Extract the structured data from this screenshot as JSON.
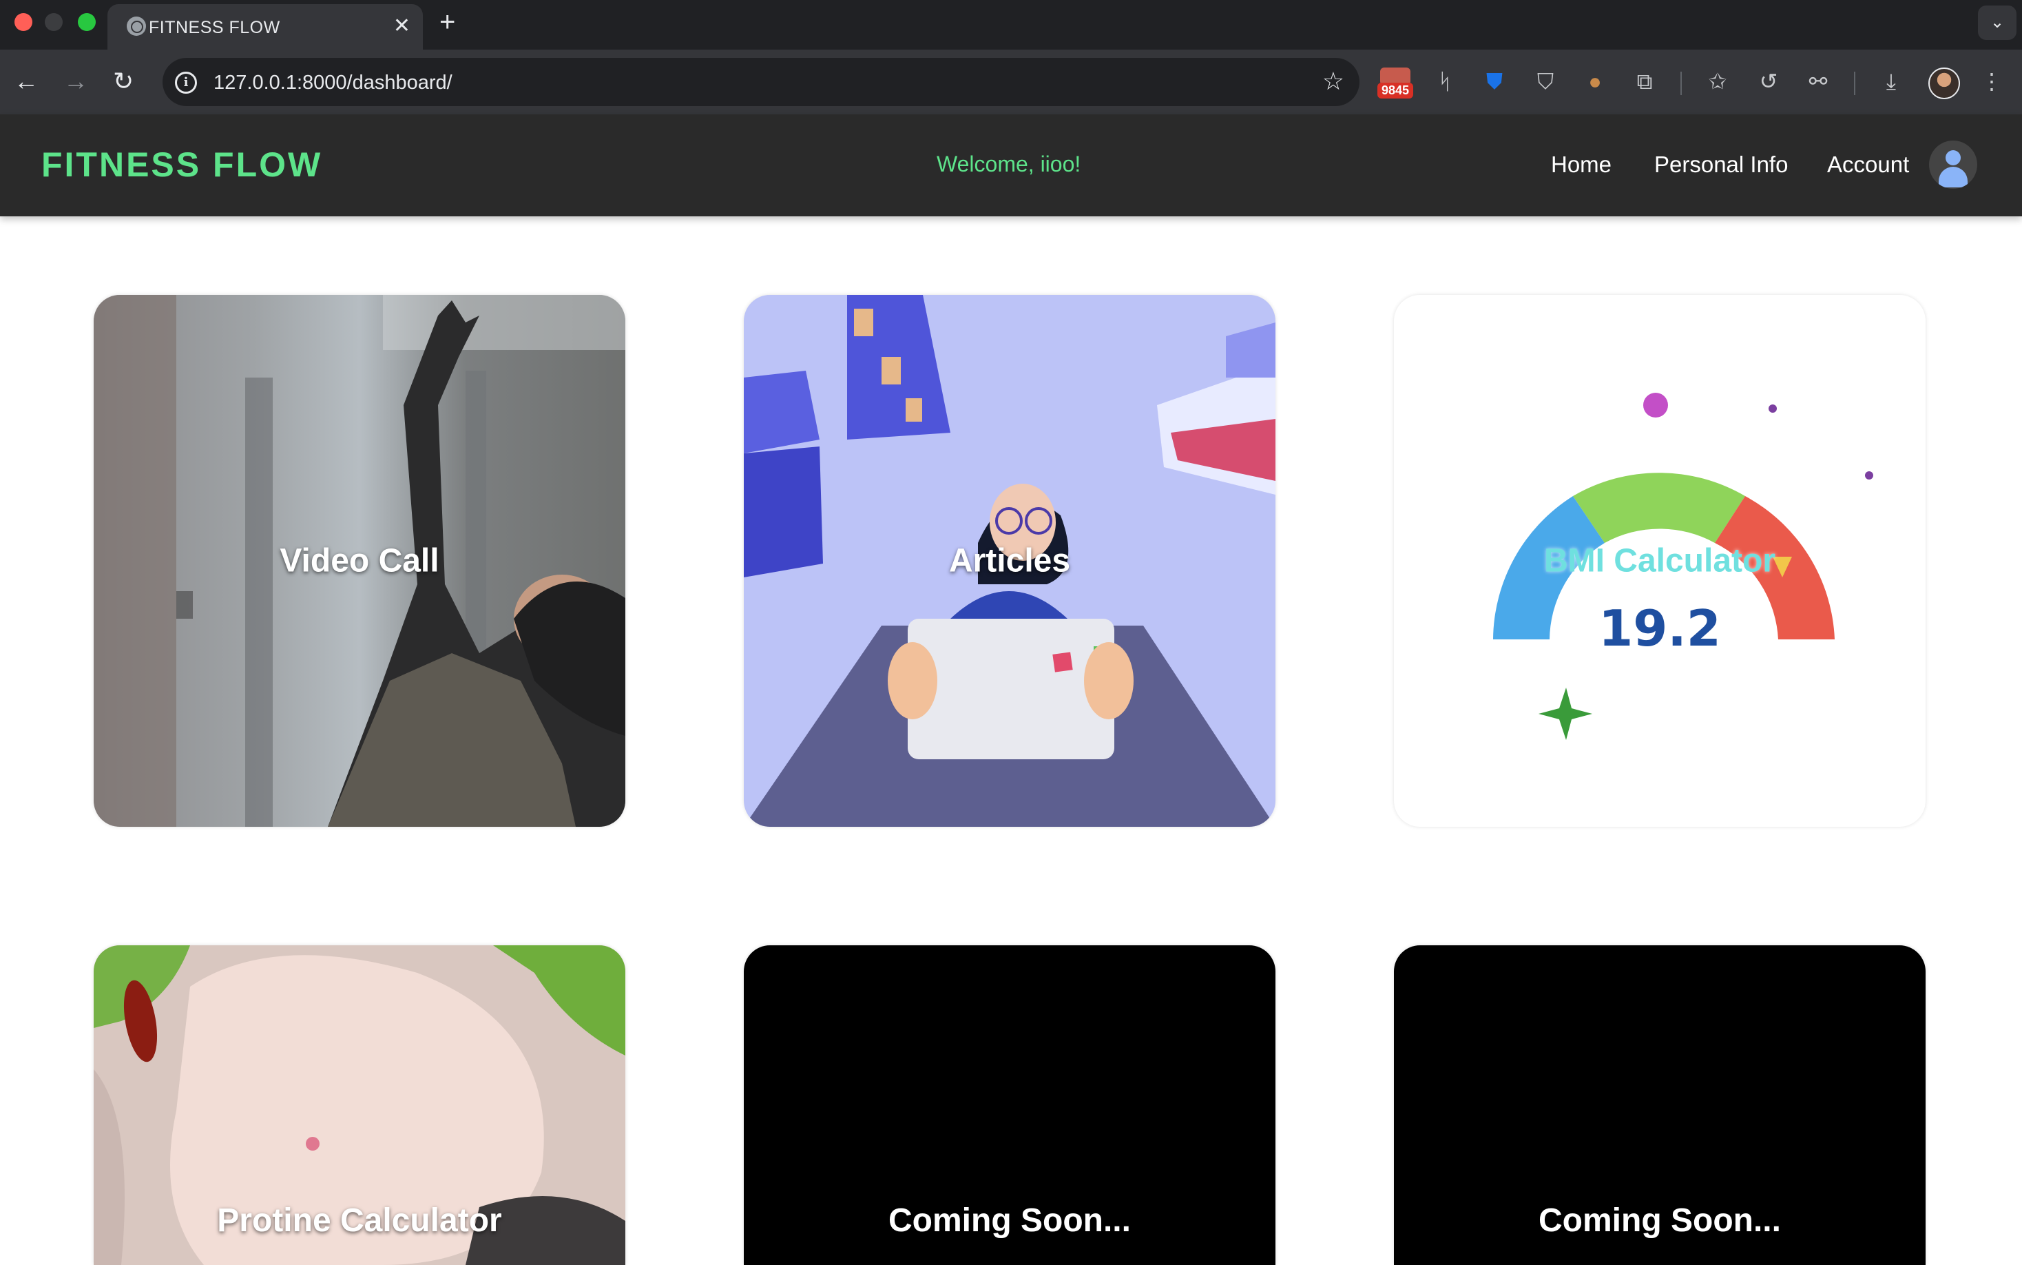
{
  "browser": {
    "tab_title": "FITNESS FLOW",
    "tab_close_glyph": "✕",
    "new_tab_glyph": "+",
    "url": "127.0.0.1:8000/dashboard/",
    "extension_badge_count": "9845",
    "icons": [
      "back-icon",
      "forward-icon",
      "reload-icon",
      "info-icon",
      "bookmark-star-icon",
      "extension-icons",
      "downloads-icon",
      "profile-avatar",
      "kebab-menu-icon"
    ]
  },
  "nav": {
    "brand": "FITNESS FLOW",
    "welcome": "Welcome, iioo!",
    "links": [
      "Home",
      "Personal Info",
      "Account"
    ]
  },
  "cards": [
    {
      "label": "Video Call"
    },
    {
      "label": "Articles"
    },
    {
      "label": "BMI Calculator",
      "bmi_value": "19.2"
    },
    {
      "label": "Protine Calculator"
    },
    {
      "label": "Coming Soon..."
    },
    {
      "label": "Coming Soon..."
    }
  ],
  "colors": {
    "brand_green": "#5de38a",
    "nav_bg": "#2a2a2a",
    "chrome_bg": "#202124",
    "toolbar_bg": "#35363a"
  }
}
